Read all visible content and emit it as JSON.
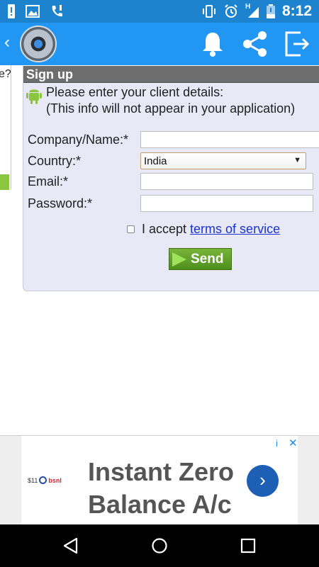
{
  "statusbar": {
    "time": "8:12",
    "network_label": "H"
  },
  "left_partial": {
    "text": "e?"
  },
  "signup": {
    "header": "Sign up",
    "intro_line1": "Please enter your client details:",
    "intro_line2": "(This info will not appear in your application)",
    "company_label": "Company/Name:*",
    "company_value": "",
    "country_label": "Country:*",
    "country_selected": "India",
    "email_label": "Email:*",
    "email_value": "",
    "password_label": "Password:*",
    "password_value": "",
    "accept_text": "I accept",
    "terms_link": "terms of service",
    "send_label": "Send"
  },
  "ad": {
    "brand_number": "$11",
    "brand_name": "bsnl",
    "headline_line1": "Instant Zero",
    "headline_line2": "Balance A/c",
    "info_icon": "i",
    "close_icon": "✕"
  },
  "colors": {
    "status_bar": "#1e83cf",
    "app_bar": "#2196f3",
    "panel_bg": "#e8e8f6",
    "header_bg": "#6e6e6e",
    "send_green": "#5a9a22",
    "link_blue": "#1a33cc"
  }
}
